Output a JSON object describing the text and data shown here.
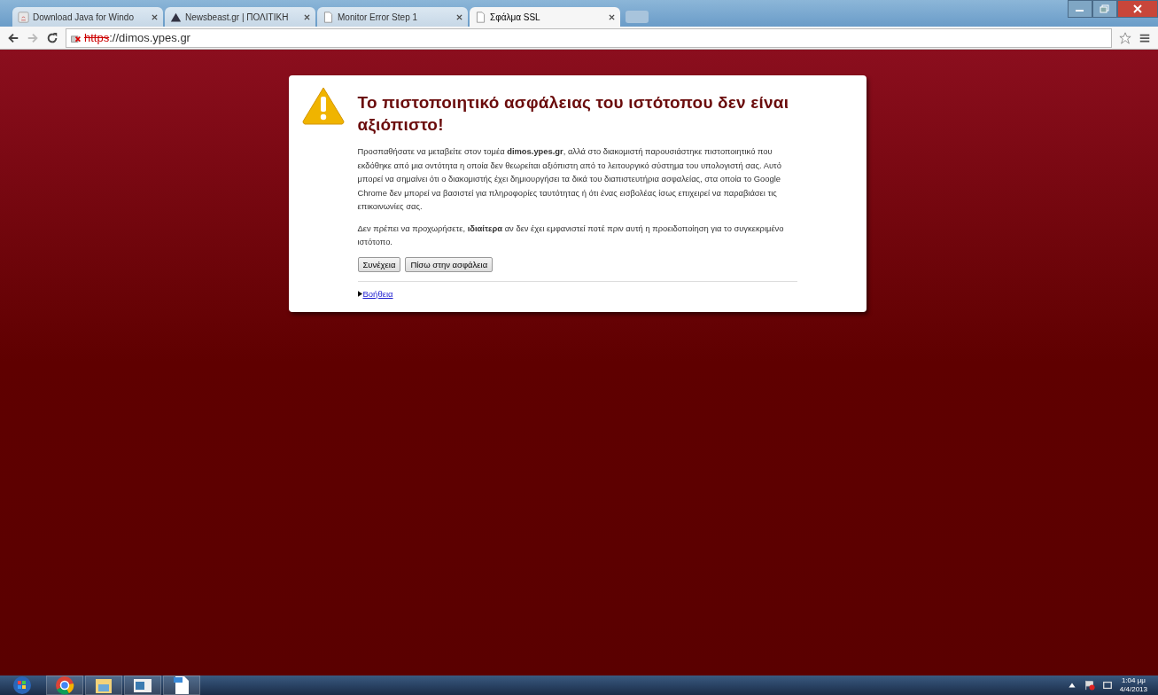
{
  "tabs": [
    {
      "title": "Download Java for Windo",
      "selected": false
    },
    {
      "title": "Newsbeast.gr | ΠΟΛΙΤΙΚΗ",
      "selected": false
    },
    {
      "title": "Monitor Error Step 1",
      "selected": false
    },
    {
      "title": "Σφάλμα SSL",
      "selected": true
    }
  ],
  "address": {
    "scheme": "https",
    "rest": "://dimos.ypes.gr"
  },
  "warning": {
    "title": "Το πιστοποιητικό ασφάλειας του ιστότοπου δεν είναι αξιόπιστο!",
    "paragraphs": [
      "Προσπαθήσατε να μεταβείτε στον τομέα **dimos.ypes.gr**, αλλά στο διακομιστή παρουσιάστηκε πιστοποιητικό που εκδόθηκε από μια οντότητα η οποία δεν θεωρείται αξιόπιστη από το λειτουργικό σύστημα του υπολογιστή σας. Αυτό μπορεί να σημαίνει ότι ο διακομιστής έχει δημιουργήσει τα δικά του διαπιστευτήρια ασφαλείας, στα οποία το Google Chrome δεν μπορεί να βασιστεί για πληροφορίες ταυτότητας ή ότι ένας εισβολέας ίσως επιχειρεί να παραβιάσει τις επικοινωνίες σας.",
      "Δεν πρέπει να προχωρήσετε, **ιδιαίτερα** αν δεν έχει εμφανιστεί ποτέ πριν αυτή η προειδοποίηση για το συγκεκριμένο ιστότοπο."
    ],
    "buttons": [
      "Συνέχεια",
      "Πίσω στην ασφάλεια"
    ],
    "help": "Βοήθεια"
  },
  "taskbar": {
    "time": "1:04 μμ",
    "date": "4/4/2013"
  }
}
